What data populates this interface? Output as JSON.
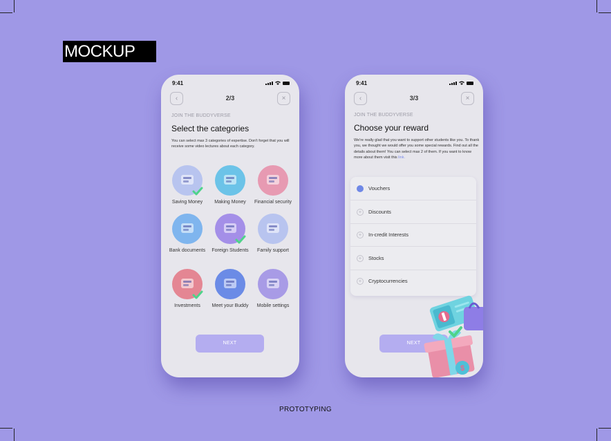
{
  "mockup_label": "MOCKUP",
  "footer_label": "PROTOTYPING",
  "colors": {
    "background": "#9f98e6",
    "phone": "#e7e6ec",
    "button": "#b4adf0",
    "accent": "#6f88e6",
    "check": "#4fd38a"
  },
  "screen1": {
    "time": "9:41",
    "back_icon": "chevron-left-icon",
    "close_icon": "close-icon",
    "step": "2/3",
    "eyebrow": "JOIN THE BUDDYVERSE",
    "title": "Select the categories",
    "description": "You can select max 3 categories of expertise. Don't forget that you will receive some video lectures about each category.",
    "categories": [
      {
        "label": "Saving Money",
        "color": "#b8c4ef",
        "icon": "wallet-icon",
        "selected": true
      },
      {
        "label": "Making Money",
        "color": "#6cc3e8",
        "icon": "cash-register-icon",
        "selected": false
      },
      {
        "label": "Financial security",
        "color": "#e79ab2",
        "icon": "shield-icon",
        "selected": false
      },
      {
        "label": "Bank documents",
        "color": "#7fb5ee",
        "icon": "documents-icon",
        "selected": false
      },
      {
        "label": "Foreign Students",
        "color": "#a48fe8",
        "icon": "airplane-icon",
        "selected": true
      },
      {
        "label": "Family support",
        "color": "#b8c4ef",
        "icon": "family-icon",
        "selected": false
      },
      {
        "label": "Investments",
        "color": "#e48693",
        "icon": "money-stack-icon",
        "selected": true
      },
      {
        "label": "Meet your Buddy",
        "color": "#6b8be6",
        "icon": "cup-icon",
        "selected": false
      },
      {
        "label": "Mobile settings",
        "color": "#a89be6",
        "icon": "gears-icon",
        "selected": false
      }
    ],
    "next_label": "NEXT"
  },
  "screen2": {
    "time": "9:41",
    "back_icon": "chevron-left-icon",
    "close_icon": "close-icon",
    "step": "3/3",
    "eyebrow": "JOIN THE BUDDYVERSE",
    "title": "Choose your reward",
    "description": "We're really glad that you want to support other students like you. To thank you, we thought we would offer you some special rewards. Find out all the details about them! You can select max 2 of them. If you want to know more about them visit this",
    "link_text": "link.",
    "rewards": [
      {
        "label": "Vouchers",
        "selected": true
      },
      {
        "label": "Discounts",
        "selected": false
      },
      {
        "label": "In-credit Interests",
        "selected": false
      },
      {
        "label": "Stocks",
        "selected": false
      },
      {
        "label": "Cryptocurrencies",
        "selected": false
      }
    ],
    "next_label": "NEXT",
    "illustration_icon": "gift-voucher-illustration"
  }
}
